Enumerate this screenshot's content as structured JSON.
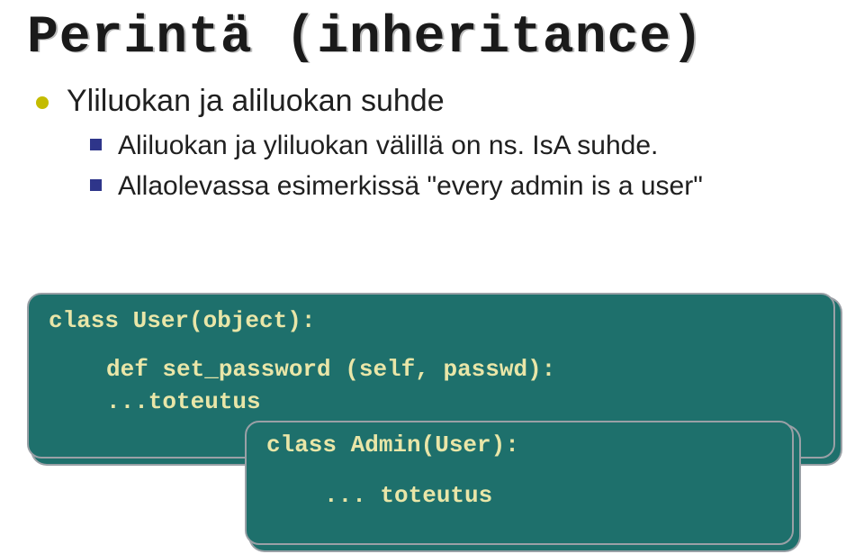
{
  "title": "Perintä (inheritance)",
  "bullets": {
    "level1": "Yliluokan ja aliluokan suhde",
    "level2a": "Aliluokan ja yliluokan välillä on ns. IsA suhde.",
    "level2b": "Allaolevassa esimerkissä \"every admin is a user\""
  },
  "code": {
    "outer": {
      "line1": "class User(object):",
      "line2": "def set_password (self, passwd):",
      "line3": "...toteutus"
    },
    "inner": {
      "line1": "class Admin(User):",
      "line2": "... toteutus"
    }
  }
}
